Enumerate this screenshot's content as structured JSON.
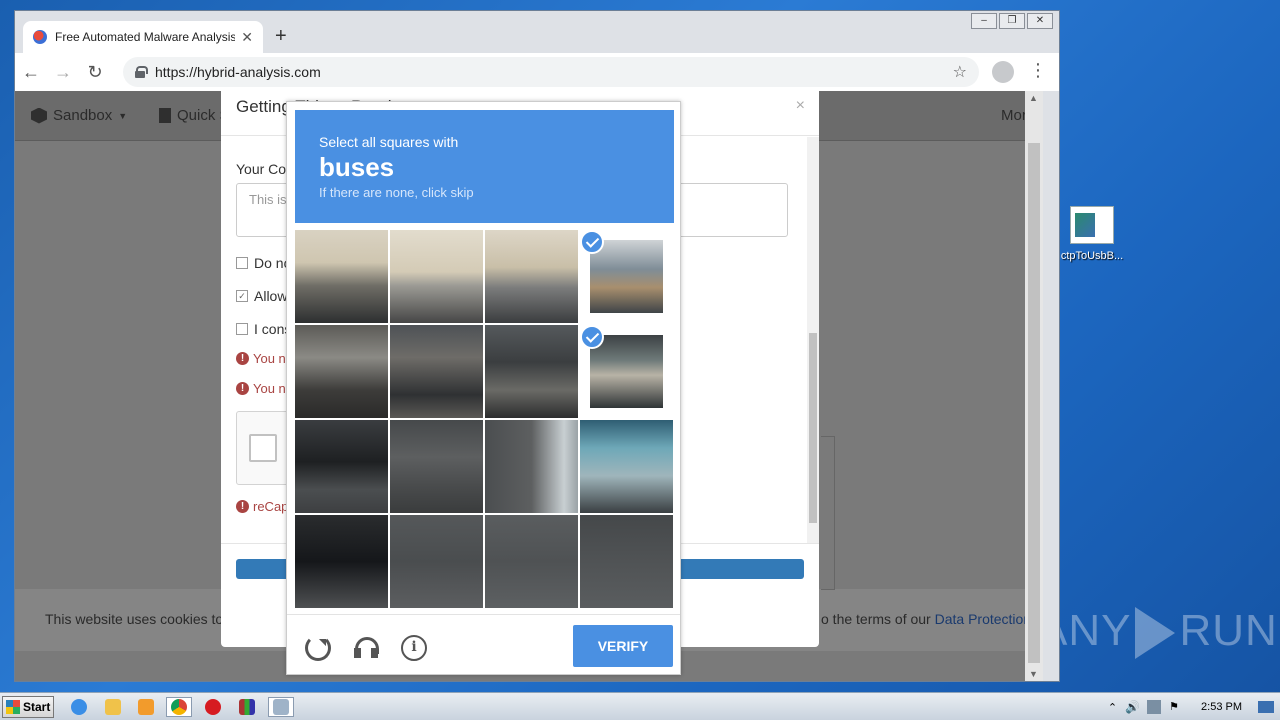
{
  "browser": {
    "tab_title": "Free Automated Malware Analysis S",
    "url": "https://hybrid-analysis.com"
  },
  "site": {
    "nav": {
      "sandbox": "Sandbox",
      "quick": "Quick S",
      "more": "More"
    },
    "cookie": {
      "left_text": "This website uses cookies to",
      "right_text": "o the terms of our",
      "link": "Data Protection"
    }
  },
  "modal": {
    "title": "Getting Things Ready",
    "close": "×",
    "comment_label": "Your Cor",
    "comment_placeholder": "This is",
    "checkboxes": [
      {
        "label": "Do no",
        "checked": false
      },
      {
        "label": "Allow",
        "checked": true
      },
      {
        "label": "I cons",
        "checked": false
      }
    ],
    "errors": [
      "You n",
      "You n"
    ],
    "recaptcha_error": "reCap"
  },
  "captcha": {
    "instruction": "Select all squares with",
    "target": "buses",
    "hint": "If there are none, click skip",
    "verify_label": "VERIFY",
    "selected_tiles": [
      3,
      7
    ]
  },
  "desktop": {
    "icon_label": "ctpToUsbB...",
    "watermark": "ANY RUN"
  },
  "taskbar": {
    "start": "Start",
    "clock": "2:53 PM"
  },
  "colors": {
    "captcha_blue": "#4a90e2",
    "error_red": "#a94442",
    "submit_blue": "#337ab7"
  }
}
